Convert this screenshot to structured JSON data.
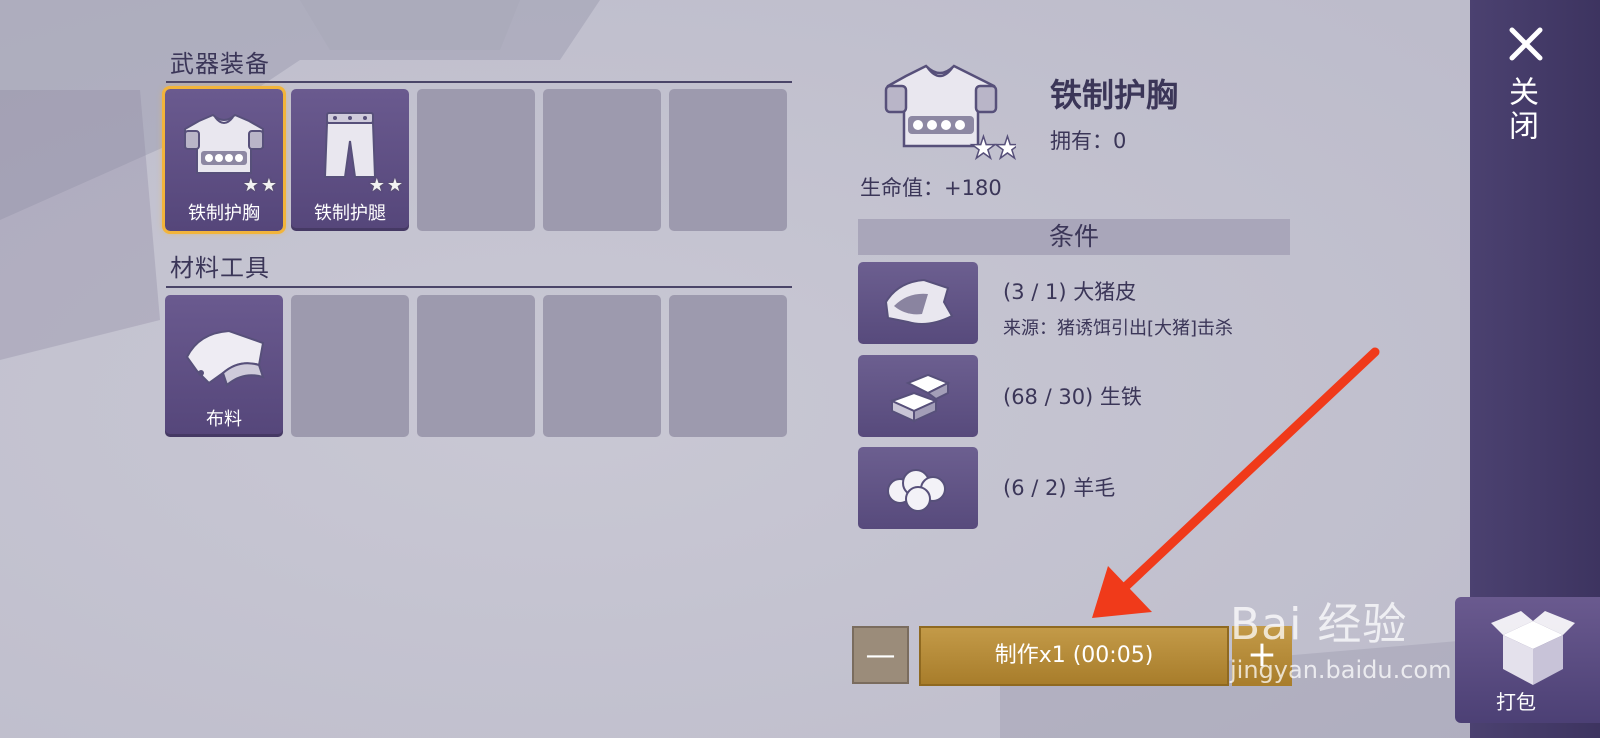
{
  "sections": {
    "weapons": {
      "title": "武器装备",
      "items": [
        {
          "label": "铁制护胸",
          "stars": 2,
          "selected": true,
          "icon": "chest-armor-icon"
        },
        {
          "label": "铁制护腿",
          "stars": 2,
          "selected": false,
          "icon": "leg-armor-icon"
        }
      ]
    },
    "materials": {
      "title": "材料工具",
      "items": [
        {
          "label": "布料",
          "icon": "cloth-icon"
        }
      ]
    }
  },
  "detail": {
    "title": "铁制护胸",
    "owned": "拥有：0",
    "stat": "生命值：+180",
    "conditions_title": "条件",
    "requirements": [
      {
        "text": "(3 / 1) 大猪皮",
        "source": "来源：猪诱饵引出[大猪]击杀",
        "icon": "hide-icon"
      },
      {
        "text": "(68 / 30) 生铁",
        "icon": "iron-ingot-icon"
      },
      {
        "text": "(6 / 2) 羊毛",
        "icon": "wool-icon"
      }
    ]
  },
  "actions": {
    "minus": "—",
    "craft": "制作x1 (00:05)",
    "plus": "+"
  },
  "sidebar": {
    "close_label": "关闭",
    "pack_label": "打包"
  },
  "watermark": {
    "line1": "Bai 经验",
    "line2": "jingyan.baidu.com"
  },
  "colors": {
    "accent": "#f2b43a",
    "craft_button": "#b58a38",
    "panel_purple": "#5f5185",
    "arrow": "#f03a1a"
  }
}
